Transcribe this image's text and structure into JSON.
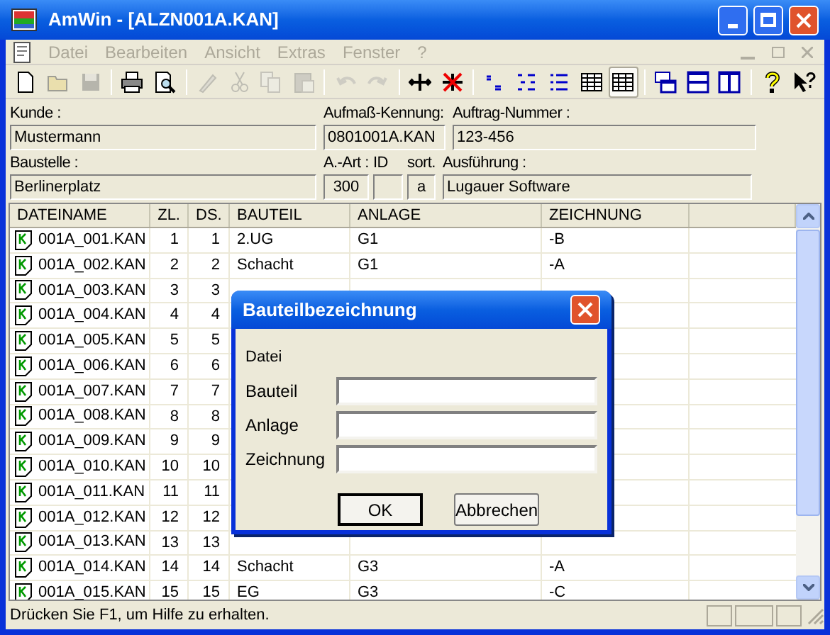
{
  "window": {
    "title": "AmWin - [ALZN001A.KAN]"
  },
  "menu": [
    {
      "label": "Datei",
      "disabled": true
    },
    {
      "label": "Bearbeiten",
      "disabled": true
    },
    {
      "label": "Ansicht",
      "disabled": true
    },
    {
      "label": "Extras",
      "disabled": true
    },
    {
      "label": "Fenster",
      "disabled": true
    },
    {
      "label": "?",
      "disabled": true
    }
  ],
  "toolbar": [
    {
      "kind": "new",
      "disabled": false,
      "selected": false
    },
    {
      "kind": "open",
      "disabled": true,
      "selected": false
    },
    {
      "kind": "save",
      "disabled": true,
      "selected": false
    },
    {
      "kind": "sep"
    },
    {
      "kind": "print",
      "disabled": false,
      "selected": false
    },
    {
      "kind": "preview",
      "disabled": false,
      "selected": false
    },
    {
      "kind": "sep"
    },
    {
      "kind": "wand",
      "disabled": true,
      "selected": false
    },
    {
      "kind": "cut",
      "disabled": true,
      "selected": false
    },
    {
      "kind": "copy",
      "disabled": true,
      "selected": false
    },
    {
      "kind": "paste",
      "disabled": true,
      "selected": false
    },
    {
      "kind": "sep"
    },
    {
      "kind": "undo",
      "disabled": true,
      "selected": false
    },
    {
      "kind": "redo",
      "disabled": true,
      "selected": false
    },
    {
      "kind": "sep"
    },
    {
      "kind": "move",
      "disabled": false,
      "selected": false
    },
    {
      "kind": "nomove",
      "disabled": false,
      "selected": false
    },
    {
      "kind": "sep"
    },
    {
      "kind": "list1",
      "disabled": false,
      "selected": false
    },
    {
      "kind": "list2",
      "disabled": false,
      "selected": false
    },
    {
      "kind": "list3",
      "disabled": false,
      "selected": false
    },
    {
      "kind": "grid",
      "disabled": false,
      "selected": false
    },
    {
      "kind": "grid",
      "disabled": false,
      "selected": true
    },
    {
      "kind": "sep"
    },
    {
      "kind": "cascade",
      "disabled": false,
      "selected": false
    },
    {
      "kind": "tileh",
      "disabled": false,
      "selected": false
    },
    {
      "kind": "tilev",
      "disabled": false,
      "selected": false
    },
    {
      "kind": "sep"
    },
    {
      "kind": "help",
      "disabled": false,
      "selected": false
    },
    {
      "kind": "helpcursor",
      "disabled": false,
      "selected": false
    }
  ],
  "form": {
    "row_1": [
      {
        "label": "Kunde :",
        "value": "Mustermann"
      },
      {
        "label": "Aufmaß-Kennung:",
        "value": "0801001A.KAN"
      },
      {
        "label": "Auftrag-Nummer :",
        "value": "123-456"
      }
    ],
    "row_2": [
      {
        "label": "Baustelle :",
        "value": "Berlinerplatz"
      },
      {
        "label": "A.-Art :",
        "value": "300"
      },
      {
        "label": "ID"
      },
      {
        "label": "sort.",
        "value": "a"
      },
      {
        "label": "Ausführung :",
        "value": "Lugauer Software"
      }
    ]
  },
  "table": {
    "columns": [
      "DATEINAME",
      "ZL.",
      "DS.",
      "BAUTEIL",
      "ANLAGE",
      "ZEICHNUNG"
    ],
    "rows": [
      [
        "001A_001.KAN",
        "1",
        "1",
        "2.UG",
        "G1",
        "-B"
      ],
      [
        "001A_002.KAN",
        "2",
        "2",
        "Schacht",
        "G1",
        "-A"
      ],
      [
        "001A_003.KAN",
        "3",
        "3"
      ],
      [
        "001A_004.KAN",
        "4",
        "4"
      ],
      [
        "001A_005.KAN",
        "5",
        "5"
      ],
      [
        "001A_006.KAN",
        "6",
        "6"
      ],
      [
        "001A_007.KAN",
        "7",
        "7"
      ],
      [
        "001A_008.KAN",
        "8",
        "8"
      ],
      [
        "001A_009.KAN",
        "9",
        "9"
      ],
      [
        "001A_010.KAN",
        "10",
        "10"
      ],
      [
        "001A_011.KAN",
        "11",
        "11"
      ],
      [
        "001A_012.KAN",
        "12",
        "12"
      ],
      [
        "001A_013.KAN",
        "13",
        "13"
      ],
      [
        "001A_014.KAN",
        "14",
        "14",
        "Schacht",
        "G3",
        "-A"
      ],
      [
        "001A_015.KAN",
        "15",
        "15",
        "EG",
        "G3",
        "-C"
      ]
    ]
  },
  "status_bar": {
    "text": "Drücken Sie F1, um Hilfe zu erhalten."
  },
  "dialog": {
    "title": "Bauteilbezeichnung",
    "caption": "Datei",
    "fields": [
      {
        "label": "Bauteil"
      },
      {
        "label": "Anlage"
      },
      {
        "label": "Zeichnung"
      }
    ],
    "buttons": [
      {
        "label": "OK",
        "default": true
      },
      {
        "label": "Abbrechen",
        "default": false
      }
    ]
  }
}
